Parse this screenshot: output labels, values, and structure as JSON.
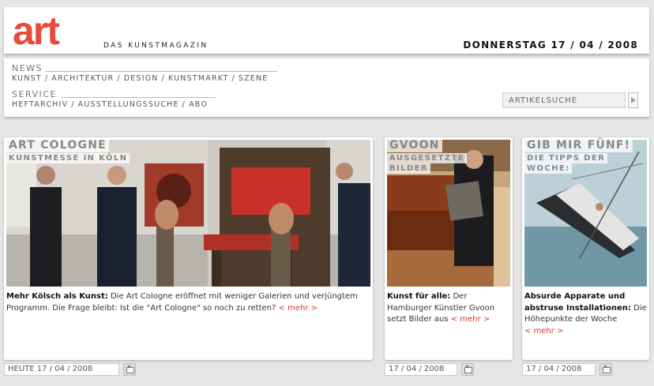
{
  "header": {
    "logo": "art",
    "tagline": "DAS KUNSTMAGAZIN",
    "date": "DONNERSTAG 17 / 04 / 2008"
  },
  "nav": {
    "news_title": "NEWS",
    "news_links": [
      "KUNST",
      "ARCHITEKTUR",
      "DESIGN",
      "KUNSTMARKT",
      "SZENE"
    ],
    "service_title": "SERVICE",
    "service_links": [
      "HEFTARCHIV",
      "AUSSTELLUNGSSUCHE",
      "ABO"
    ],
    "search_placeholder": "ARTIKELSUCHE"
  },
  "cards": [
    {
      "title": "ART COLOGNE",
      "subtitle_lines": [
        "KUNSTMESSE IN KÖLN"
      ],
      "lead": "Mehr Kölsch als Kunst:",
      "body": " Die Art Cologne eröffnet mit weniger Galerien und verjüngtem Programm. Die Frage bleibt: Ist die \"Art Cologne\" so noch zu retten?",
      "more": "< mehr >",
      "date": "HEUTE 17 / 04 / 2008"
    },
    {
      "title": "GVOON",
      "subtitle_lines": [
        "AUSGESETZTE",
        "BILDER"
      ],
      "lead": "Kunst für alle:",
      "body": " Der Hamburger Künstler Gvoon setzt Bilder aus",
      "more": "< mehr >",
      "date": "17 / 04 / 2008"
    },
    {
      "title": "GIB MIR FÜNF!",
      "subtitle_lines": [
        "DIE TIPPS DER",
        "WOCHE:"
      ],
      "lead": "Absurde Apparate und abstruse Installationen:",
      "body": " Die Höhepunkte der Woche",
      "more": "< mehr >",
      "date": "17 / 04 / 2008"
    }
  ]
}
